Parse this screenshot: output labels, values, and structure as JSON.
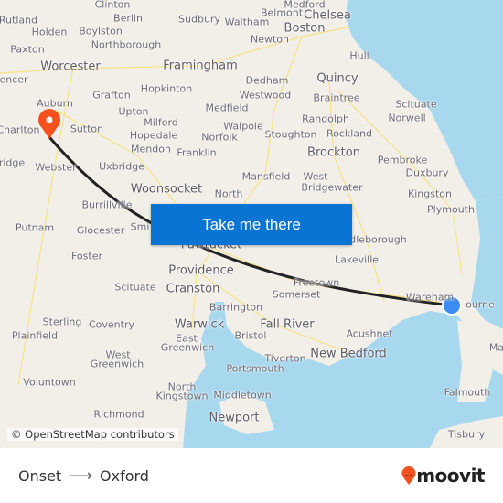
{
  "map": {
    "labels": [
      {
        "text": "Clinton"
      },
      {
        "text": "Berlin"
      },
      {
        "text": "Sudbury"
      },
      {
        "text": "Waltham"
      },
      {
        "text": "Medford"
      },
      {
        "text": "Belmont"
      },
      {
        "text": "Chelsea",
        "big": true
      },
      {
        "text": "Boston",
        "big": true
      },
      {
        "text": "Rutland"
      },
      {
        "text": "Holden"
      },
      {
        "text": "Boylston"
      },
      {
        "text": "Paxton"
      },
      {
        "text": "Northborough"
      },
      {
        "text": "Newton"
      },
      {
        "text": "Hull"
      },
      {
        "text": "Worcester",
        "big": true
      },
      {
        "text": "Framingham",
        "big": true
      },
      {
        "text": "encer"
      },
      {
        "text": "Hopkinton"
      },
      {
        "text": "Dedham"
      },
      {
        "text": "Quincy",
        "big": true
      },
      {
        "text": "Grafton"
      },
      {
        "text": "Westwood"
      },
      {
        "text": "Braintree"
      },
      {
        "text": "Scituate"
      },
      {
        "text": "Auburn"
      },
      {
        "text": "Upton"
      },
      {
        "text": "Medfield"
      },
      {
        "text": "Randolph"
      },
      {
        "text": "Norwell"
      },
      {
        "text": "Milford"
      },
      {
        "text": "Walpole"
      },
      {
        "text": "Charlton"
      },
      {
        "text": "Sutton"
      },
      {
        "text": "Hopedale"
      },
      {
        "text": "Norfolk"
      },
      {
        "text": "Stoughton"
      },
      {
        "text": "Rockland"
      },
      {
        "text": "Mendon"
      },
      {
        "text": "Franklin"
      },
      {
        "text": "Brockton",
        "big": true
      },
      {
        "text": "Pembroke"
      },
      {
        "text": "Webster"
      },
      {
        "text": "Uxbridge"
      },
      {
        "text": "Mansfield"
      },
      {
        "text": "West"
      },
      {
        "text": "Bridgewater"
      },
      {
        "text": "Duxbury"
      },
      {
        "text": "ridge"
      },
      {
        "text": "Woonsocket",
        "big": true
      },
      {
        "text": "North"
      },
      {
        "text": "Kingston"
      },
      {
        "text": "Burrillville"
      },
      {
        "text": "Plymouth"
      },
      {
        "text": "Putnam"
      },
      {
        "text": "Glocester"
      },
      {
        "text": "Smi"
      },
      {
        "text": "Pawtucket",
        "big": true
      },
      {
        "text": "ddleborough"
      },
      {
        "text": "Foster"
      },
      {
        "text": "Lakeville"
      },
      {
        "text": "Providence",
        "big": true
      },
      {
        "text": "Scituate"
      },
      {
        "text": "Cranston",
        "big": true
      },
      {
        "text": "Freetown"
      },
      {
        "text": "Somerset"
      },
      {
        "text": "Wareham"
      },
      {
        "text": "ourne"
      },
      {
        "text": "Barrington"
      },
      {
        "text": "Sterling"
      },
      {
        "text": "Coventry"
      },
      {
        "text": "Warwick",
        "big": true
      },
      {
        "text": "Fall River",
        "big": true
      },
      {
        "text": "Acushnet"
      },
      {
        "text": "Plainfield"
      },
      {
        "text": "Bristol"
      },
      {
        "text": "East"
      },
      {
        "text": "Greenwich"
      },
      {
        "text": "Ma"
      },
      {
        "text": "West"
      },
      {
        "text": "Greenwich"
      },
      {
        "text": "New Bedford",
        "big": true
      },
      {
        "text": "Tiverton"
      },
      {
        "text": "Portsmouth"
      },
      {
        "text": "Voluntown"
      },
      {
        "text": "North"
      },
      {
        "text": "Kingstown"
      },
      {
        "text": "Middletown"
      },
      {
        "text": "Falmouth"
      },
      {
        "text": "Richmond"
      },
      {
        "text": "Newport",
        "big": true
      },
      {
        "text": "Tisbury"
      }
    ],
    "cta_label": "Take me there",
    "attribution": "© OpenStreetMap contributors",
    "destination_pin_color": "#f4511e",
    "origin_marker_color": "#3d8bf2",
    "route_color": "#222222",
    "water_color": "#a8d8ee",
    "land_color": "#f2efe9",
    "button_color": "#0a74d4"
  },
  "footer": {
    "origin": "Onset",
    "arrow_icon": "arrow-right-icon",
    "destination": "Oxford",
    "brand": "moovit",
    "brand_color": "#f4511e"
  }
}
